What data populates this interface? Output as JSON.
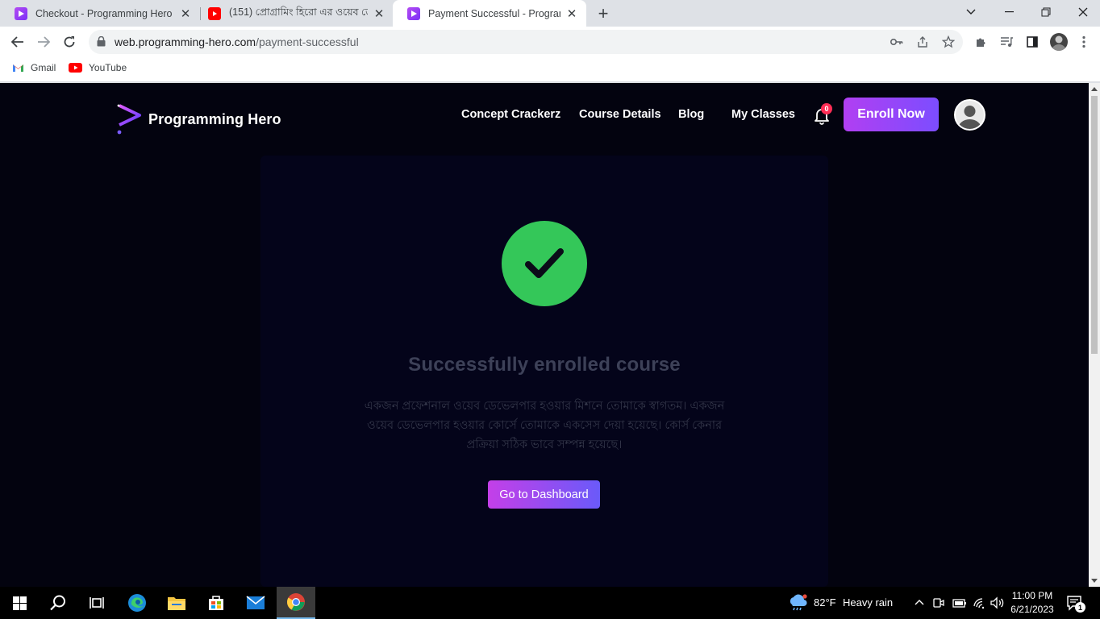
{
  "browser": {
    "tabs": [
      {
        "title": "Checkout - Programming Hero",
        "icon": "programming-hero-favicon",
        "active": false
      },
      {
        "title": "(151) প্রোগ্রামিং হিরো এর ওয়েব ডে",
        "icon": "youtube-favicon",
        "active": false
      },
      {
        "title": "Payment Successful - Programmi",
        "icon": "programming-hero-favicon",
        "active": true
      }
    ],
    "url_host": "web.programming-hero.com",
    "url_path": "/payment-successful",
    "bookmarks": [
      {
        "label": "Gmail",
        "icon": "gmail-icon"
      },
      {
        "label": "YouTube",
        "icon": "youtube-icon"
      }
    ]
  },
  "site": {
    "brand": "Programming Hero",
    "nav": [
      "Concept Crackerz",
      "Course Details",
      "Blog",
      "My Classes"
    ],
    "notification_count": "0",
    "enroll_label": "Enroll Now"
  },
  "success": {
    "title": "Successfully enrolled course",
    "message": "একজন প্রফেশনাল ওয়েব ডেভেলপার হওয়ার মিশনে তোমাকে স্বাগতম। একজন ওয়েব ডেভেলপার হওয়ার কোর্সে তোমাকে একসেস দেয়া হয়েছে। কোর্স কেনার প্রক্রিয়া সঠিক ভাবে সম্পন্ন হয়েছে।",
    "button_label": "Go to Dashboard",
    "accent": "#34c759"
  },
  "taskbar": {
    "weather_temp": "82°F",
    "weather_text": "Heavy rain",
    "time": "11:00 PM",
    "date": "6/21/2023",
    "notification_count": "1"
  }
}
